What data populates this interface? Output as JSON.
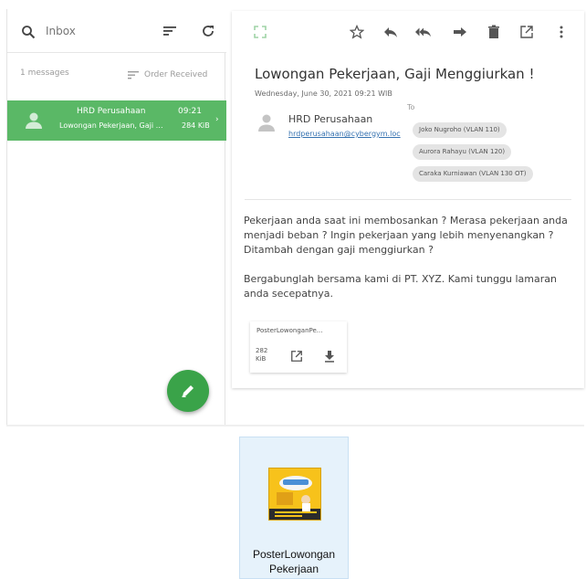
{
  "search": {
    "placeholder": "Inbox",
    "value": ""
  },
  "list": {
    "count_label": "1 messages",
    "order_label": "Order Received",
    "items": [
      {
        "sender": "HRD Perusahaan",
        "time": "09:21",
        "subject": "Lowongan Pekerjaan, Gaji M...",
        "size": "284 KiB"
      }
    ]
  },
  "message": {
    "subject": "Lowongan Pekerjaan, Gaji Menggiurkan !",
    "date": "Wednesday, June 30, 2021 09:21 WIB",
    "sender_name": "HRD Perusahaan",
    "sender_email": "hrdperusahaan@cybergym.loc",
    "to_label": "To",
    "recipients": [
      "Joko Nugroho (VLAN 110)",
      "Aurora Rahayu (VLAN 120)",
      "Caraka Kurniawan (VLAN 130 OT)"
    ],
    "body": [
      "Pekerjaan anda saat ini membosankan ? Merasa pekerjaan anda menjadi beban ? Ingin pekerjaan yang lebih menyenangkan ? Ditambah dengan gaji menggiurkan ?",
      "Bergabunglah bersama kami di PT. XYZ. Kami tunggu lamaran anda secepatnya."
    ],
    "attachment": {
      "name": "PosterLowonganPe...",
      "size": "282 KiB"
    }
  },
  "desktop_file": {
    "label_line1": "PosterLowongan",
    "label_line2": "Pekerjaan"
  },
  "colors": {
    "accent": "#5ab866",
    "fab": "#3aa349",
    "link": "#3572b0",
    "chip": "#e4e4e4"
  },
  "icons": {
    "search": "search-icon",
    "sort": "sort-icon",
    "refresh": "refresh-icon",
    "compose": "pencil-icon",
    "star": "star-icon",
    "reply": "reply-icon",
    "reply_all": "reply-all-icon",
    "forward": "forward-icon",
    "delete": "trash-icon",
    "open": "open-external-icon",
    "more": "more-vertical-icon",
    "download": "download-icon"
  }
}
